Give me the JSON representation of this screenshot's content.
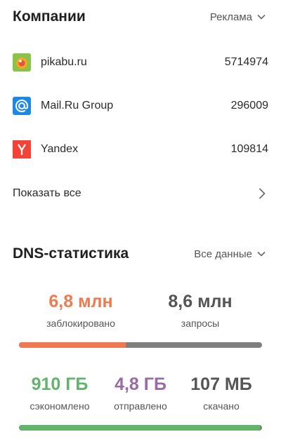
{
  "companies": {
    "title": "Компании",
    "filter_label": "Реклама",
    "items": [
      {
        "name": "pikabu.ru",
        "count": "5714974",
        "icon": "pikabu-icon"
      },
      {
        "name": "Mail.Ru Group",
        "count": "296009",
        "icon": "mailru-at-icon"
      },
      {
        "name": "Yandex",
        "count": "109814",
        "icon": "yandex-icon"
      }
    ],
    "show_all_label": "Показать все"
  },
  "dns": {
    "title": "DNS-статистика",
    "filter_label": "Все данные",
    "requests": {
      "blocked_value": "6,8 млн",
      "blocked_label": "заблокировано",
      "total_value": "8,6 млн",
      "total_label": "запросы",
      "blocked_fraction": 0.44
    },
    "traffic": {
      "saved_value": "910 ГБ",
      "saved_label": "сэкономлено",
      "sent_value": "4,8 ГБ",
      "sent_label": "отправлено",
      "downloaded_value": "107 МБ",
      "downloaded_label": "скачано",
      "saved_fraction": 0.99
    }
  },
  "colors": {
    "blocked": "#f07a4f",
    "neutral": "#555555",
    "saved": "#62b36b",
    "sent": "#9b6aa5",
    "bar_track": "#7f7f7f",
    "mailru_blue": "#1e88e5",
    "yandex_red": "#f44336",
    "pikabu_green": "#8bc34a"
  }
}
